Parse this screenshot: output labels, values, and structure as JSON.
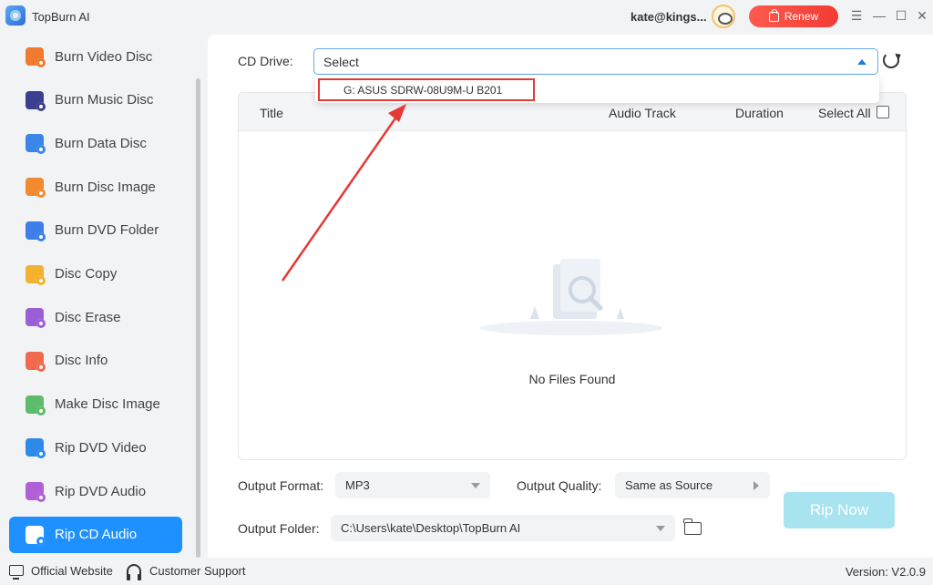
{
  "app": {
    "title": "TopBurn AI",
    "user_email": "kate@kings...",
    "renew_label": "Renew"
  },
  "colors": {
    "accent": "#1e90ff",
    "renew": "#f23b35",
    "highlight_border": "#e53935",
    "rip_button_disabled": "#a8e4f0"
  },
  "sidebar": {
    "items": [
      {
        "label": "Burn Video Disc",
        "icon": "video-disc-icon",
        "color": "#f07a2e"
      },
      {
        "label": "Burn Music Disc",
        "icon": "music-disc-icon",
        "color": "#3b3f8f"
      },
      {
        "label": "Burn Data Disc",
        "icon": "data-disc-icon",
        "color": "#3a86e8"
      },
      {
        "label": "Burn Disc Image",
        "icon": "disc-image-icon",
        "color": "#f28a30"
      },
      {
        "label": "Burn DVD Folder",
        "icon": "dvd-folder-icon",
        "color": "#3d7ee8"
      },
      {
        "label": "Disc Copy",
        "icon": "disc-copy-icon",
        "color": "#f2b12e"
      },
      {
        "label": "Disc Erase",
        "icon": "disc-erase-icon",
        "color": "#9a5fd6"
      },
      {
        "label": "Disc Info",
        "icon": "disc-info-icon",
        "color": "#f06a4e"
      },
      {
        "label": "Make Disc Image",
        "icon": "make-image-icon",
        "color": "#5cbc6a"
      },
      {
        "label": "Rip DVD Video",
        "icon": "rip-dvd-video-icon",
        "color": "#2e8ae8"
      },
      {
        "label": "Rip DVD Audio",
        "icon": "rip-dvd-audio-icon",
        "color": "#b05fd6"
      },
      {
        "label": "Rip CD Audio",
        "icon": "rip-cd-audio-icon",
        "color": "#ffffff",
        "active": true
      }
    ]
  },
  "main": {
    "cd_drive_label": "CD Drive:",
    "cd_drive_value": "Select",
    "dropdown_option": "G: ASUS SDRW-08U9M-U B201",
    "table": {
      "col_title": "Title",
      "col_audio_track": "Audio Track",
      "col_duration": "Duration",
      "select_all": "Select All",
      "empty_text": "No Files Found"
    },
    "output_format_label": "Output Format:",
    "output_format_value": "MP3",
    "output_quality_label": "Output Quality:",
    "output_quality_value": "Same as Source",
    "output_folder_label": "Output Folder:",
    "output_folder_value": "C:\\Users\\kate\\Desktop\\TopBurn AI",
    "rip_button": "Rip Now"
  },
  "footer": {
    "official_website": "Official Website",
    "customer_support": "Customer Support",
    "version": "Version: V2.0.9"
  }
}
